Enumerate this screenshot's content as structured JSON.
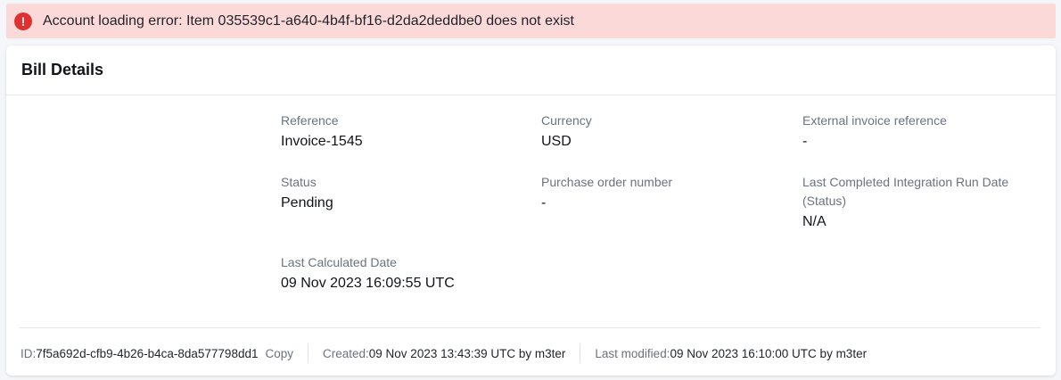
{
  "alert": {
    "icon": "error-icon",
    "icon_glyph": "!",
    "message": "Account loading error: Item 035539c1-a640-4b4f-bf16-d2da2deddbe0 does not exist",
    "color": "#e03131"
  },
  "card": {
    "title": "Bill Details",
    "fields": {
      "reference": {
        "label": "Reference",
        "value": "Invoice-1545"
      },
      "currency": {
        "label": "Currency",
        "value": "USD"
      },
      "external_ref": {
        "label": "External invoice reference",
        "value": "-"
      },
      "status": {
        "label": "Status",
        "value": "Pending"
      },
      "po_number": {
        "label": "Purchase order number",
        "value": "-"
      },
      "integration_run": {
        "label": "Last Completed Integration Run Date (Status)",
        "value": "N/A"
      },
      "last_calculated": {
        "label": "Last Calculated Date",
        "value": "09 Nov 2023 16:09:55 UTC"
      }
    }
  },
  "footer": {
    "id_label": "ID: ",
    "id_value": "7f5a692d-cfb9-4b26-b4ca-8da577798dd1",
    "copy_label": "Copy",
    "created_label": "Created: ",
    "created_value": "09 Nov 2023 13:43:39 UTC by m3ter",
    "modified_label": "Last modified: ",
    "modified_value": "09 Nov 2023 16:10:00 UTC by m3ter"
  }
}
